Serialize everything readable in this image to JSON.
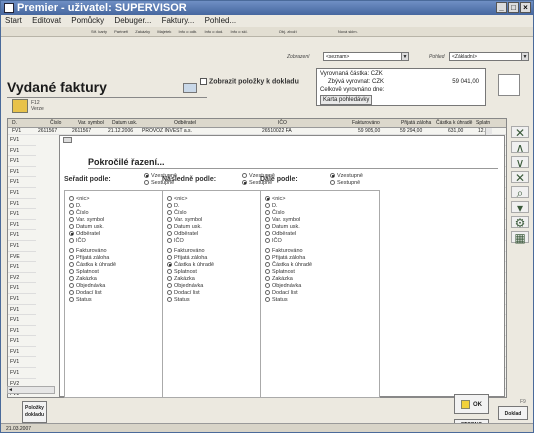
{
  "window": {
    "title": "Premier - uživatel: SUPERVISOR"
  },
  "menu": [
    "Start",
    "Editovat",
    "Pomůcky",
    "Debuger...",
    "Faktury...",
    "Pohled..."
  ],
  "toolbar": [
    "Stř. karty",
    "Partneři",
    "Zakázky",
    "Majetek",
    "Info o odb.",
    "Info o dod.",
    "Info o skl.",
    "Obj. zboží",
    "Nová sklm."
  ],
  "filter": {
    "label": "Zobrazení",
    "value": "<seznam>",
    "view_label": "Pohled",
    "view_value": "<Základní>"
  },
  "page": {
    "title": "Vydané faktury",
    "toggle_label": "Zobrazit položky k dokladu"
  },
  "summary": {
    "lines": [
      "Vyrovnaná částka: CZK",
      "Zbývá vyrovnat: CZK",
      "Celkově vyrovnáno dne:"
    ],
    "amount": "59 041,00",
    "card_button": "Karta pohledávky"
  },
  "mini_toolbar": {
    "key": "F12",
    "label": "Verze"
  },
  "grid": {
    "columns": [
      "D.",
      "Číslo",
      "Var. symbol",
      "Datum usk.",
      "Odběratel",
      "IČO",
      "Fakturováno",
      "Přijatá záloha",
      "Částka k úhradě",
      "Splatn"
    ],
    "first_row": [
      "FV1",
      "2611567",
      "2611567",
      "21.12.2006",
      "PROVOZ INVEST a.s.",
      "26510022 FA",
      "59 905,00",
      "59 294,00",
      "631,00",
      "12.10"
    ],
    "left_codes": [
      "FV1",
      "FV1",
      "FV1",
      "FV1",
      "FV1",
      "FV1",
      "FV1",
      "FV1",
      "FV1",
      "FV1",
      "FV1",
      "FVE",
      "FV1",
      "FV2",
      "FV1",
      "FV1",
      "FV1",
      "FV1",
      "FV1",
      "FV1",
      "FV1",
      "FV1",
      "FV1",
      "FV2",
      "FV1",
      "FV1"
    ],
    "right_codes": [
      "1:",
      "1:",
      "1:",
      "1:",
      "2:",
      "2:",
      "2:",
      "2:",
      "2:",
      "2:",
      "0:",
      "2:",
      "0:",
      "2:",
      "1:",
      "0:",
      "2:",
      "2:",
      "2:",
      "1:",
      "2:",
      "0:",
      "2:",
      "1:"
    ]
  },
  "dialog": {
    "title": "Pokročilé řazení...",
    "columns": [
      {
        "label": "Seřadit podle:",
        "asc": "Vzestupně",
        "desc": "Sestupně",
        "selected": "Odběratel",
        "dir": "asc"
      },
      {
        "label": "Následně podle:",
        "asc": "Vzestupně",
        "desc": "Sestupně",
        "selected": "Částka k úhradě",
        "dir": "desc"
      },
      {
        "label": "Dále podle:",
        "asc": "Vzestupně",
        "desc": "Sestupně",
        "selected": "<nic>",
        "dir": "asc"
      }
    ],
    "options": [
      "<nic>",
      "D.",
      "Číslo",
      "Var. symbol",
      "Datum usk.",
      "Odběratel",
      "IČO",
      "",
      "Fakturováno",
      "Přijatá záloha",
      "Částka k úhradě",
      "Splatnost",
      "Zakázka",
      "Objednávka",
      "Dodací list",
      "Status"
    ]
  },
  "buttons": {
    "ok": "OK",
    "cancel": "STORNO",
    "polozky": [
      "Položky",
      "dokladu"
    ],
    "doklad": "Doklad",
    "page_no": "F9"
  },
  "statusbar": {
    "date": "21.03.2007"
  }
}
